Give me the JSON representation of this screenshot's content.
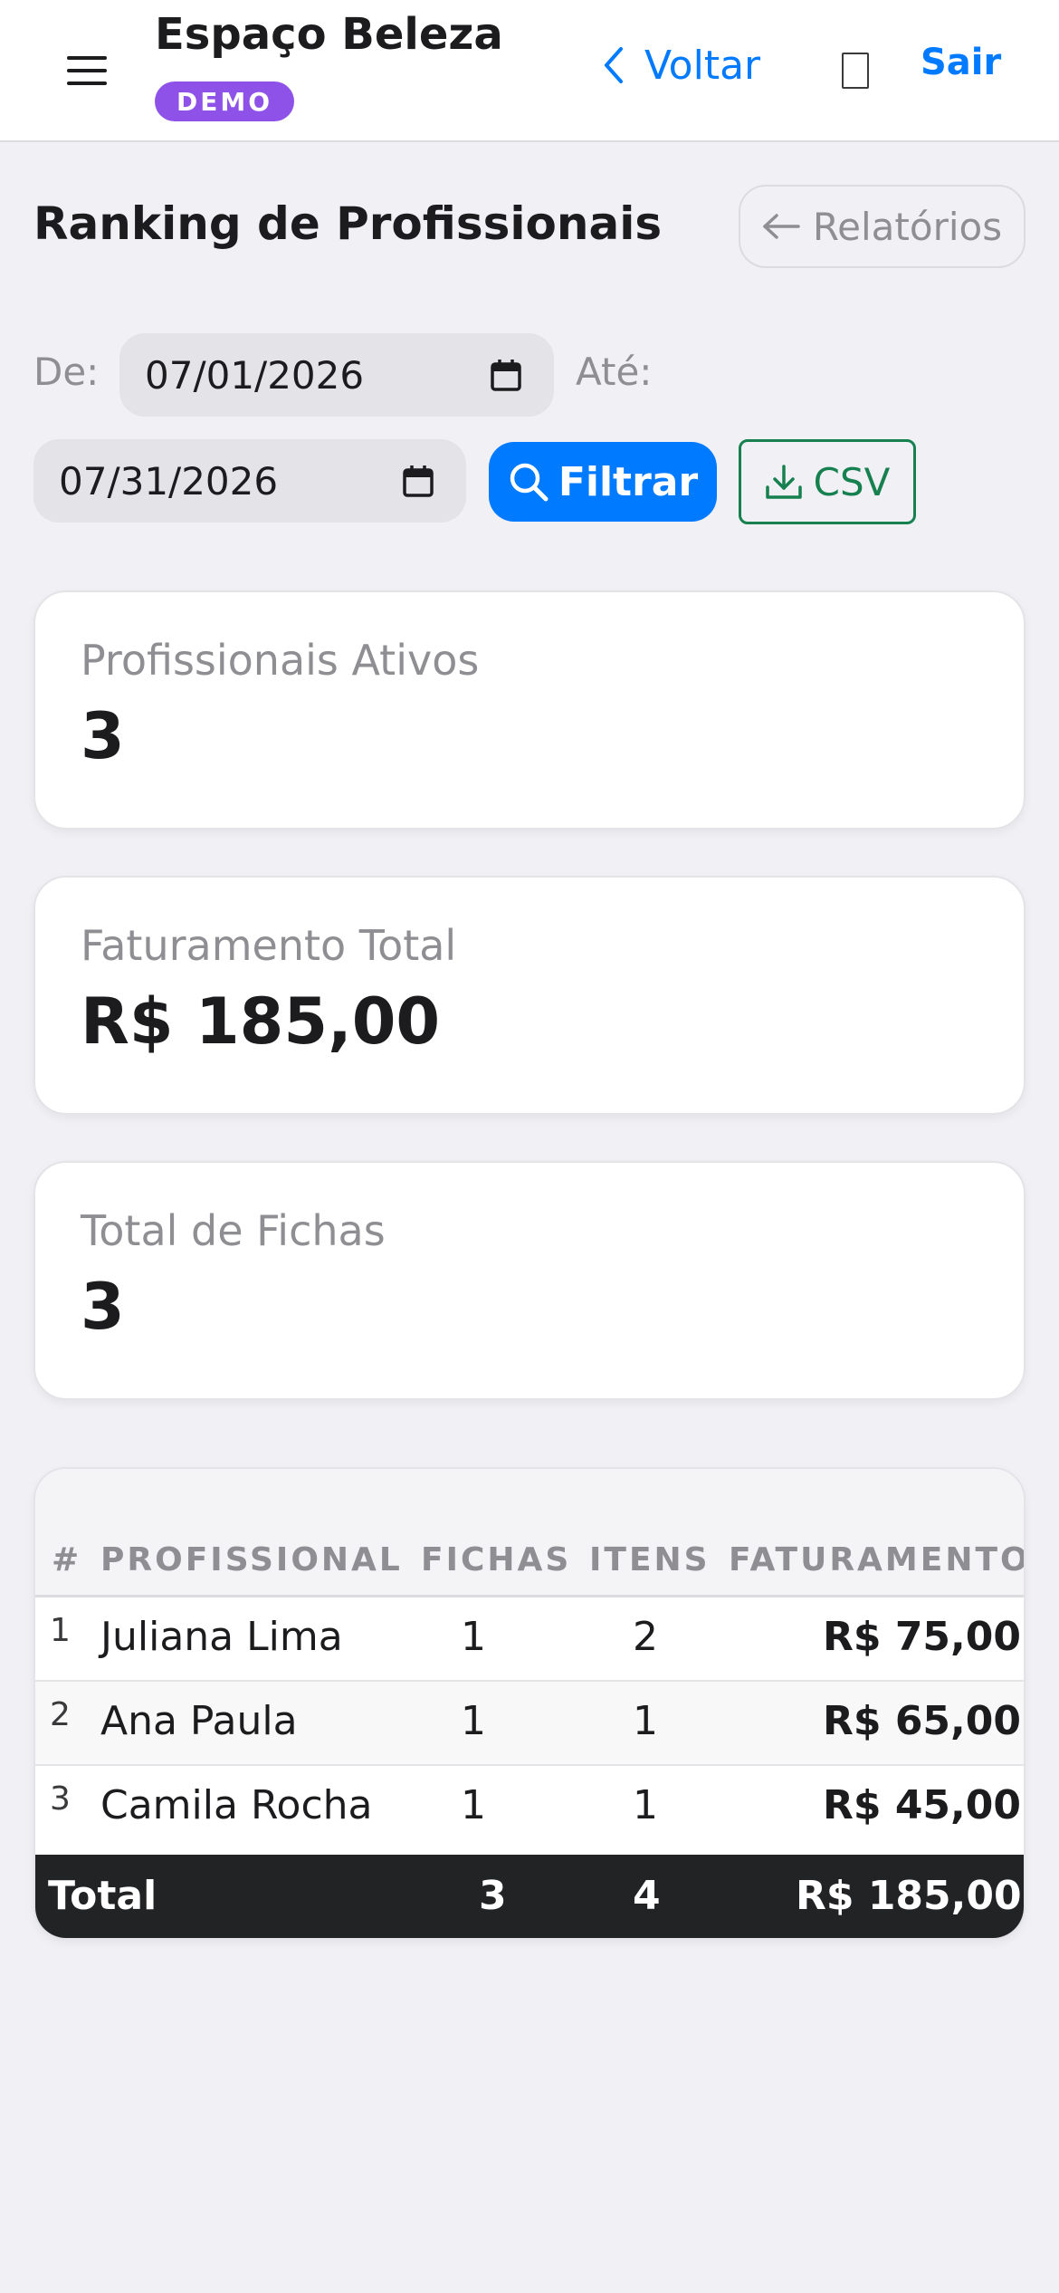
{
  "header": {
    "title": "Espaço Beleza",
    "badge": "DEMO",
    "back_label": "Voltar",
    "logout_label": "Sair"
  },
  "page": {
    "title": "Ranking de Profissionais",
    "reports_button": "Relatórios"
  },
  "filters": {
    "from_label": "De:",
    "from_value": "07/01/2026",
    "to_label": "Até:",
    "to_value": "07/31/2026",
    "filter_button": "Filtrar",
    "csv_button": "CSV"
  },
  "stats": [
    {
      "label": "Profissionais Ativos",
      "value": "3"
    },
    {
      "label": "Faturamento Total",
      "value": "R$ 185,00"
    },
    {
      "label": "Total de Fichas",
      "value": "3"
    }
  ],
  "table": {
    "columns": [
      "#",
      "PROFISSIONAL",
      "FICHAS",
      "ITENS",
      "FATURAMENTO"
    ],
    "rows": [
      {
        "rank": "1",
        "name": "Juliana Lima",
        "fichas": "1",
        "itens": "2",
        "faturamento": "R$ 75,00"
      },
      {
        "rank": "2",
        "name": "Ana Paula",
        "fichas": "1",
        "itens": "1",
        "faturamento": "R$ 65,00"
      },
      {
        "rank": "3",
        "name": "Camila Rocha",
        "fichas": "1",
        "itens": "1",
        "faturamento": "R$ 45,00"
      }
    ],
    "total": {
      "label": "Total",
      "fichas": "3",
      "itens": "4",
      "faturamento": "R$ 185,00"
    }
  },
  "colors": {
    "accent": "#007aff",
    "badge": "#8e52e8",
    "csv": "#17804f",
    "total_row": "#212325"
  }
}
